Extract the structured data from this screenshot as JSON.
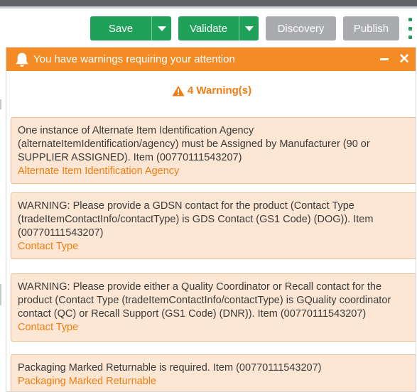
{
  "toolbar": {
    "save_label": "Save",
    "validate_label": "Validate",
    "discovery_label": "Discovery",
    "publish_label": "Publish"
  },
  "panel": {
    "title": "You have warnings requiring your attention",
    "warning_count_label": "4 Warning(s)",
    "warnings": [
      {
        "message": "One instance of Alternate Item Identification Agency (alternateItemIdentification/agency) must be Assigned by Manufacturer (90 or SUPPLIER ASSIGNED). Item (00770111543207)",
        "link": "Alternate Item Identification Agency"
      },
      {
        "message": "WARNING: Please provide a GDSN contact for the product (Contact Type (tradeItemContactInfo/contactType) is GDS Contact (GS1 Code) (DOG)). Item (00770111543207)",
        "link": "Contact Type"
      },
      {
        "message": "WARNING: Please provide either a Quality Coordinator or Recall contact for the product (Contact Type (tradeItemContactInfo/contactType) is GQuality coordinator contact (QC) or Recall Support (GS1 Code) (DNR)). Item (00770111543207)",
        "link": "Contact Type"
      },
      {
        "message": "Packaging Marked Returnable is required. Item (00770111543207)",
        "link": "Packaging Marked Returnable"
      }
    ]
  },
  "colors": {
    "primary_green": "#1fa15a",
    "disabled_gray": "#a9abae",
    "warning_orange": "#f58b24",
    "warning_text_orange": "#f07d12",
    "warning_card_bg": "#fde7d4"
  },
  "icons": {
    "header": "bell-icon",
    "count": "warning-triangle-icon",
    "menu": "kebab-menu-icon"
  }
}
